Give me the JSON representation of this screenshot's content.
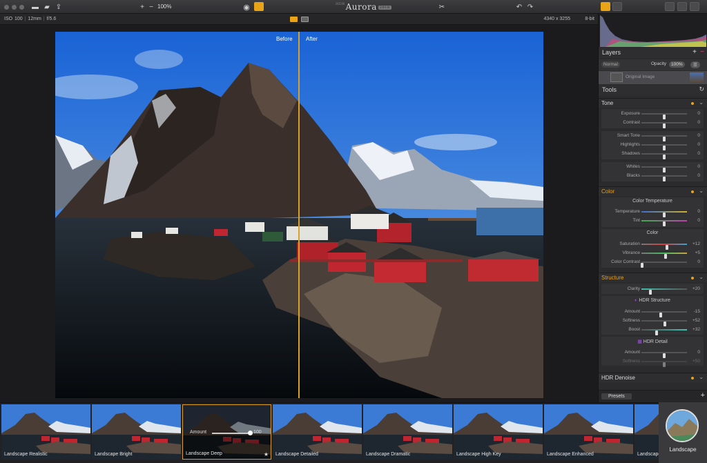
{
  "toolbar": {
    "zoom_in": "+",
    "zoom_out": "−",
    "zoom_level": "100%",
    "app_title": "Aurora",
    "app_title_prefix": "HDR",
    "app_title_badge": "2018"
  },
  "info": {
    "iso": "ISO 100",
    "focal": "12mm",
    "aperture": "f/5.6",
    "dimensions": "4340 x 3255",
    "bit_depth": "8-bit"
  },
  "canvas": {
    "before_label": "Before",
    "after_label": "After"
  },
  "layers": {
    "title": "Layers",
    "add": "+",
    "remove": "−",
    "blend_mode": "Normal",
    "opacity_label": "Opacity",
    "opacity_value": "100%",
    "layer_name": "Original Image"
  },
  "tools": {
    "title": "Tools",
    "tone": {
      "title": "Tone",
      "rows": [
        {
          "label": "Exposure",
          "value": "0",
          "pos": 0.5
        },
        {
          "label": "Contrast",
          "value": "0",
          "pos": 0.5
        },
        {
          "label": "Smart Tone",
          "value": "0",
          "pos": 0.5
        },
        {
          "label": "Highlights",
          "value": "0",
          "pos": 0.5
        },
        {
          "label": "Shadows",
          "value": "0",
          "pos": 0.5
        },
        {
          "label": "Whites",
          "value": "0",
          "pos": 0.5
        },
        {
          "label": "Blacks",
          "value": "0",
          "pos": 0.5
        }
      ]
    },
    "color": {
      "title": "Color",
      "temp_title": "Color Temperature",
      "temperature": {
        "label": "Temperature",
        "value": "0",
        "pos": 0.5
      },
      "tint": {
        "label": "Tint",
        "value": "0",
        "pos": 0.5
      },
      "color_title": "Color",
      "saturation": {
        "label": "Saturation",
        "value": "+12",
        "pos": 0.56
      },
      "vibrance": {
        "label": "Vibrance",
        "value": "+5",
        "pos": 0.53
      },
      "contrast": {
        "label": "Color Contrast",
        "value": "0",
        "pos": 0.02
      }
    },
    "structure": {
      "title": "Structure",
      "clarity": {
        "label": "Clarity",
        "value": "+20",
        "pos": 0.2
      },
      "hdr_structure_title": "HDR Structure",
      "amount": {
        "label": "Amount",
        "value": "-15",
        "pos": 0.43
      },
      "softness": {
        "label": "Softness",
        "value": "+52",
        "pos": 0.52
      },
      "boost": {
        "label": "Boost",
        "value": "+32",
        "pos": 0.33
      },
      "hdr_detail_title": "HDR Detail",
      "detail_amount": {
        "label": "Amount",
        "value": "0",
        "pos": 0.5
      },
      "detail_softness": {
        "label": "Softness",
        "value": "+50",
        "pos": 0.5
      }
    },
    "denoise": {
      "title": "HDR Denoise"
    },
    "presets_button": "Presets",
    "presets_add": "+"
  },
  "presets": [
    {
      "name": "Landscape Realistic"
    },
    {
      "name": "Landscape Bright"
    },
    {
      "name": "Landscape Deep",
      "amount_label": "Amount",
      "amount_value": "100",
      "star": "★"
    },
    {
      "name": "Landscape Detailed"
    },
    {
      "name": "Landscape Dramatic"
    },
    {
      "name": "Landscape High Key"
    },
    {
      "name": "Landscape Enhanced"
    },
    {
      "name": "Landscape"
    }
  ],
  "category": {
    "label": "Landscape"
  },
  "colors": {
    "accent": "#e8a317",
    "divider": "#d9a12a",
    "panel": "#2b2b2e"
  }
}
